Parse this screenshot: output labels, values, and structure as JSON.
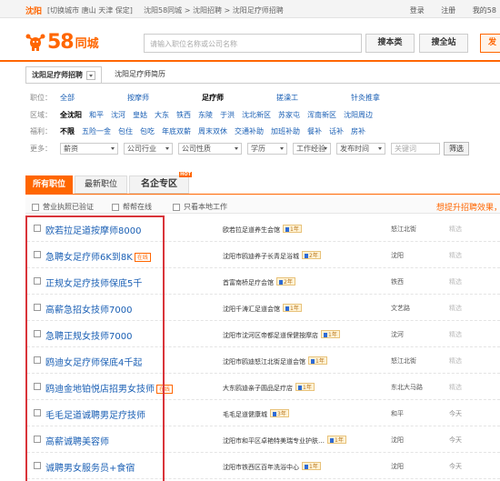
{
  "topbar": {
    "city": "沈阳",
    "switch_links": "[切换城市  唐山  天津  保定]",
    "breadcrumb": "沈阳58同城 > 沈阳招聘 > 沈阳足疗师招聘",
    "login": "登录",
    "register": "注册",
    "my58": "我的58"
  },
  "header": {
    "brand": "58",
    "brand_suffix": "同城",
    "search_placeholder": "请输入职位名称或公司名称",
    "search_job_label": "搜本类",
    "search_all_label": "搜全站",
    "post_label": "发"
  },
  "nav_tabs": {
    "active": "沈阳足疗师招聘",
    "other": "沈阳足疗师简历"
  },
  "filters": {
    "position": {
      "label": "职位：",
      "items": [
        "全部",
        "按摩师",
        "足疗师",
        "搓澡工",
        "针灸推拿"
      ]
    },
    "area": {
      "label": "区域：",
      "items": [
        "全沈阳",
        "和平",
        "沈河",
        "皇姑",
        "大东",
        "铁西",
        "东陵",
        "于洪",
        "沈北新区",
        "苏家屯",
        "浑南新区",
        "沈阳周边"
      ]
    },
    "benefits": {
      "label": "福利：",
      "items": [
        "不限",
        "五险一金",
        "包住",
        "包吃",
        "年底双薪",
        "周末双休",
        "交通补助",
        "加班补助",
        "餐补",
        "话补",
        "房补"
      ]
    },
    "more": {
      "label": "更多：",
      "selects": [
        "薪资",
        "公司行业",
        "公司性质",
        "学历",
        "工作经验",
        "发布时间"
      ],
      "keyword_placeholder": "关键词",
      "filter_button": "筛选"
    }
  },
  "section_tabs": {
    "all": "所有职位",
    "latest": "最新职位",
    "famous": "名企专区",
    "hot_badge": "HOT"
  },
  "options": {
    "license": "营业执照已验证",
    "help": "帮帮在线",
    "local": "只看本地工作",
    "promo": "想提升招聘效果，"
  },
  "listings": [
    {
      "title": "欧若拉足道按摩师8000",
      "company": "欧若拉足道养生会馆",
      "years": "1年",
      "location": "怒江北街",
      "date": "精选",
      "online": ""
    },
    {
      "title": "急聘女足疗师6K到8K",
      "company": "沈阳市鸥迪养子长青足浴城",
      "years": "2年",
      "location": "沈阳",
      "date": "精选",
      "online": "在线"
    },
    {
      "title": "正规女足疗技师保底5千",
      "company": "首富南桥足疗会馆",
      "years": "2年",
      "location": "铁西",
      "date": "精选",
      "online": ""
    },
    {
      "title": "高薪急招女技师7000",
      "company": "沈阳千涛汇足道会馆",
      "years": "1年",
      "location": "文艺路",
      "date": "精选",
      "online": ""
    },
    {
      "title": "急聘正规女技师7000",
      "company": "沈阳市沈河区帝都足道保健按摩店",
      "years": "1年",
      "location": "沈河",
      "date": "精选",
      "online": ""
    },
    {
      "title": "鸥迪女足疗师保底4千起",
      "company": "沈阳市鸥迪怒江北街足道会馆",
      "years": "1年",
      "location": "怒江北街",
      "date": "精选",
      "online": ""
    },
    {
      "title": "鸥迪金地铂悦店招男女技师",
      "company": "大东鸥迪亲子圆品足疗店",
      "years": "1年",
      "location": "东北大马路",
      "date": "精选",
      "online": "在线"
    },
    {
      "title": "毛毛足道诚聘男足疗技师",
      "company": "毛毛足道健康城",
      "years": "3年",
      "location": "和平",
      "date": "今天",
      "online": ""
    },
    {
      "title": "高薪诚聘美容师",
      "company": "沈阳市和平区卓艳特美瑞专业护肤…",
      "years": "1年",
      "location": "沈阳",
      "date": "今天",
      "online": ""
    },
    {
      "title": "诚聘男女服务员+食宿",
      "company": "沈阳市铁西区百年洗浴中心",
      "years": "1年",
      "location": "沈阳",
      "date": "今天",
      "online": ""
    }
  ]
}
